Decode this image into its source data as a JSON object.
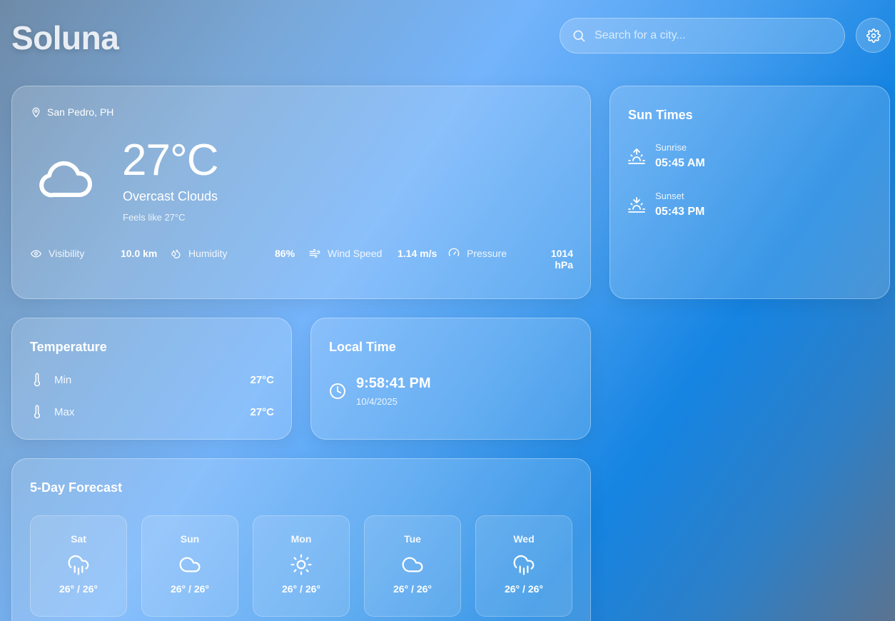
{
  "app": {
    "title": "Soluna"
  },
  "search": {
    "placeholder": "Search for a city..."
  },
  "current": {
    "location": "San Pedro, PH",
    "temperature": "27°C",
    "description": "Overcast Clouds",
    "feels_like": "Feels like 27°C",
    "icon": "cloud-icon",
    "stats": [
      {
        "label": "Visibility",
        "value": "10.0 km",
        "icon": "eye-icon"
      },
      {
        "label": "Humidity",
        "value": "86%",
        "icon": "droplets-icon"
      },
      {
        "label": "Wind Speed",
        "value": "1.14 m/s",
        "icon": "wind-icon"
      },
      {
        "label": "Pressure",
        "value": "1014 hPa",
        "icon": "gauge-icon"
      }
    ]
  },
  "sun_times": {
    "title": "Sun Times",
    "sunrise": {
      "label": "Sunrise",
      "value": "05:45 AM",
      "icon": "sunrise-icon"
    },
    "sunset": {
      "label": "Sunset",
      "value": "05:43 PM",
      "icon": "sunset-icon"
    }
  },
  "temperature": {
    "title": "Temperature",
    "min": {
      "label": "Min",
      "value": "27°C",
      "icon": "thermometer-icon"
    },
    "max": {
      "label": "Max",
      "value": "27°C",
      "icon": "thermometer-icon"
    }
  },
  "local_time": {
    "title": "Local Time",
    "time": "9:58:41 PM",
    "date": "10/4/2025",
    "icon": "clock-icon"
  },
  "forecast": {
    "title": "5-Day Forecast",
    "days": [
      {
        "day": "Sat",
        "range": "26° / 26°",
        "icon": "cloud-rain-icon"
      },
      {
        "day": "Sun",
        "range": "26° / 26°",
        "icon": "cloud-icon"
      },
      {
        "day": "Mon",
        "range": "26° / 26°",
        "icon": "sun-icon"
      },
      {
        "day": "Tue",
        "range": "26° / 26°",
        "icon": "cloud-icon"
      },
      {
        "day": "Wed",
        "range": "26° / 26°",
        "icon": "cloud-rain-icon"
      }
    ]
  }
}
